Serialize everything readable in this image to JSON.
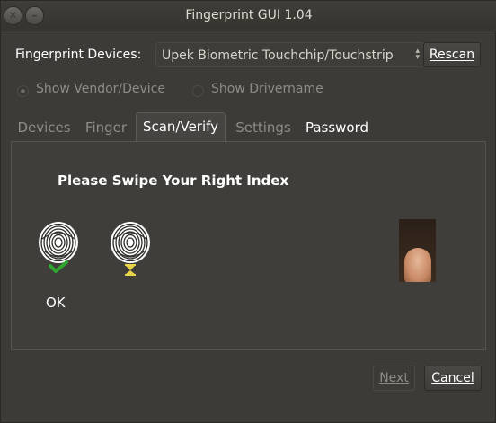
{
  "window": {
    "title": "Fingerprint GUI 1.04",
    "close_glyph": "✕",
    "minimize_glyph": "–"
  },
  "devices": {
    "label": "Fingerprint Devices:",
    "selected": "Upek Biometric Touchchip/Touchstrip",
    "rescan_label": "Rescan"
  },
  "options": {
    "show_vendor_device": "Show Vendor/Device",
    "show_drivername": "Show Drivername",
    "selected": "Show Vendor/Device"
  },
  "tabs": [
    {
      "label": "Devices"
    },
    {
      "label": "Finger"
    },
    {
      "label": "Scan/Verify"
    },
    {
      "label": "Settings"
    },
    {
      "label": "Password"
    }
  ],
  "active_tab": "Scan/Verify",
  "scan": {
    "instruction": "Please Swipe Your Right Index",
    "result_label": "OK",
    "icons": [
      "fingerprint-ok-icon",
      "fingerprint-waiting-icon",
      "finger-swipe-image"
    ],
    "colors": {
      "ok_check": "#2fa52f",
      "hourglass": "#e8d24a"
    }
  },
  "footer": {
    "next_label": "Next",
    "cancel_label": "Cancel"
  }
}
